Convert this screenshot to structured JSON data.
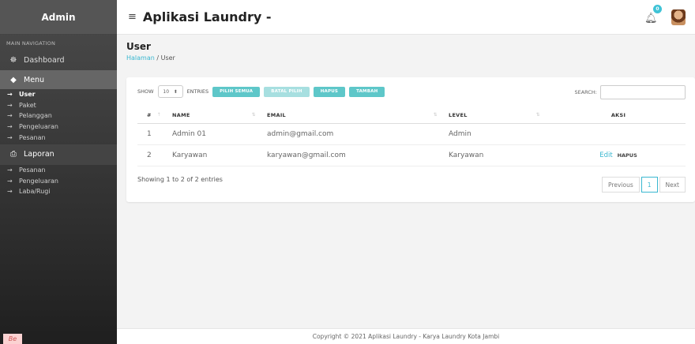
{
  "sidebar": {
    "brand": "Admin",
    "nav_header": "MAIN NAVIGATION",
    "dashboard": "Dashboard",
    "menu": {
      "label": "Menu",
      "items": [
        "User",
        "Paket",
        "Pelanggan",
        "Pengeluaran",
        "Pesanan"
      ]
    },
    "laporan": {
      "label": "Laporan",
      "items": [
        "Pesanan",
        "Pengeluaran",
        "Laba/Rugi"
      ]
    }
  },
  "topbar": {
    "title": "Aplikasi Laundry -",
    "notification_count": "0"
  },
  "page": {
    "title": "User",
    "breadcrumb_link": "Halaman",
    "breadcrumb_current": "User"
  },
  "controls": {
    "show_label": "SHOW",
    "entries_value": "10",
    "entries_label": "ENTRIES",
    "buttons": [
      "PILIH SEMUA",
      "BATAL PILIH",
      "HAPUS",
      "TAMBAH"
    ],
    "search_label": "SEARCH:"
  },
  "table": {
    "headers": [
      "#",
      "NAME",
      "EMAIL",
      "LEVEL",
      "AKSI"
    ],
    "rows": [
      {
        "no": "1",
        "name": "Admin 01",
        "email": "admin@gmail.com",
        "level": "Admin",
        "edit": "",
        "hapus": ""
      },
      {
        "no": "2",
        "name": "Karyawan",
        "email": "karyawan@gmail.com",
        "level": "Karyawan",
        "edit": "Edit",
        "hapus": "HAPUS"
      }
    ]
  },
  "info": "Showing 1 to 2 of 2 entries",
  "pagination": {
    "previous": "Previous",
    "current": "1",
    "next": "Next"
  },
  "footer": "Copyright © 2021 Aplikasi Laundry - Karya Laundry Kota Jambi"
}
